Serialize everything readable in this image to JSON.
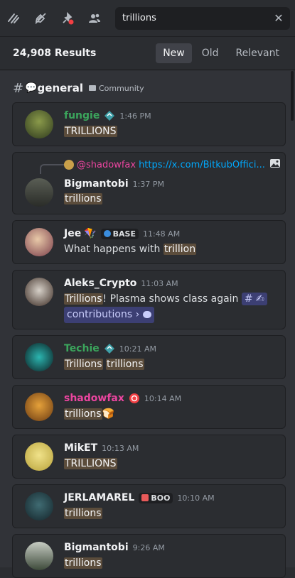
{
  "toolbar": {
    "icons": [
      "threads-icon",
      "mute-icon",
      "pins-icon",
      "members-icon"
    ]
  },
  "search": {
    "value": "trillions",
    "placeholder": "Search"
  },
  "results": {
    "count": "24,908 Results",
    "sorts": [
      {
        "label": "New",
        "active": true
      },
      {
        "label": "Old",
        "active": false
      },
      {
        "label": "Relevant",
        "active": false
      }
    ]
  },
  "channel": {
    "hash": "#",
    "emoji": "💬",
    "name": "general",
    "category": "Community"
  },
  "messages": [
    {
      "author": "fungie",
      "color": "#3ba55c",
      "time": "1:46 PM",
      "badge": "server-badge-icon",
      "text_parts": [
        "",
        "TRILLIONS",
        ""
      ]
    },
    {
      "reply_mention": "@shadowfax",
      "reply_link": "https://x.com/BitkubOffici...",
      "author": "Bigmantobi",
      "color": "#f2f3f5",
      "time": "1:37 PM",
      "text_parts": [
        "",
        "trillions",
        ""
      ]
    },
    {
      "author": "Jee",
      "color": "#f2f3f5",
      "author_emoji": "🪁",
      "tag": "BASE",
      "time": "11:48 AM",
      "text_parts": [
        "What happens with ",
        "trillion",
        ""
      ]
    },
    {
      "author": "Aleks_Crypto",
      "color": "#f2f3f5",
      "time": "11:03 AM",
      "text_parts": [
        "",
        "Trillions",
        "! Plasma shows class again "
      ],
      "chip": "# ✍",
      "channel_chip": "contributions"
    },
    {
      "author": "Techie",
      "color": "#3ba55c",
      "time": "10:21 AM",
      "badge": "server-badge-icon",
      "text_parts": [
        "",
        "Trillions",
        " "
      ],
      "text_hl2": "trillions"
    },
    {
      "author": "shadowfax",
      "color": "#eb459f",
      "time": "10:14 AM",
      "badge": "record-badge-icon",
      "text_parts": [
        "",
        "trillions",
        ""
      ],
      "emoji_after": "🍞"
    },
    {
      "author": "MikET",
      "color": "#f2f3f5",
      "time": "10:13 AM",
      "text_parts": [
        "",
        "TRILLIONS",
        ""
      ]
    },
    {
      "author": "JERLAMAREL",
      "color": "#f2f3f5",
      "tag": "BOO",
      "time": "10:10 AM",
      "text_parts": [
        "",
        "trillions",
        ""
      ]
    },
    {
      "author": "Bigmantobi",
      "color": "#f2f3f5",
      "time": "9:26 AM",
      "text_parts": [
        "",
        "trillions",
        ""
      ]
    }
  ]
}
